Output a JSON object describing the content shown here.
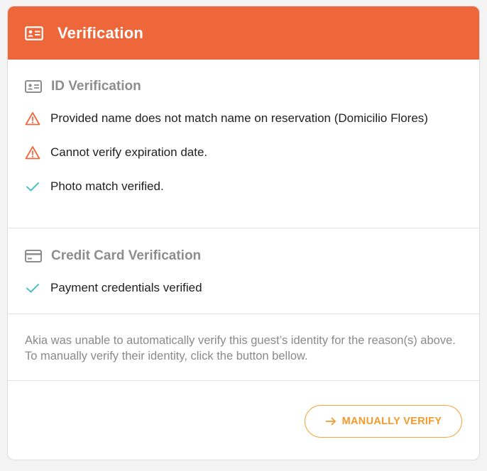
{
  "colors": {
    "header_bg": "#ee673a",
    "warning": "#ee673a",
    "success": "#38b9c4",
    "button_accent": "#f6a53a",
    "muted": "#8d8d8d"
  },
  "header": {
    "title": "Verification",
    "icon": "id-card-icon"
  },
  "id_section": {
    "title": "ID Verification",
    "icon": "id-card-icon",
    "items": [
      {
        "status": "warning",
        "icon": "warning-triangle-icon",
        "text": "Provided name does not match name on reservation (Domicilio Flores)"
      },
      {
        "status": "warning",
        "icon": "warning-triangle-icon",
        "text": "Cannot verify expiration date."
      },
      {
        "status": "success",
        "icon": "check-icon",
        "text": "Photo match verified."
      }
    ]
  },
  "cc_section": {
    "title": "Credit Card Verification",
    "icon": "credit-card-icon",
    "items": [
      {
        "status": "success",
        "icon": "check-icon",
        "text": "Payment credentials verified"
      }
    ]
  },
  "message": "Akia was unable to automatically verify this guest’s identity for the reason(s) above. To manually verify their identity, click the button bellow.",
  "button": {
    "label": "MANUALLY VERIFY",
    "icon": "arrow-right-icon"
  }
}
